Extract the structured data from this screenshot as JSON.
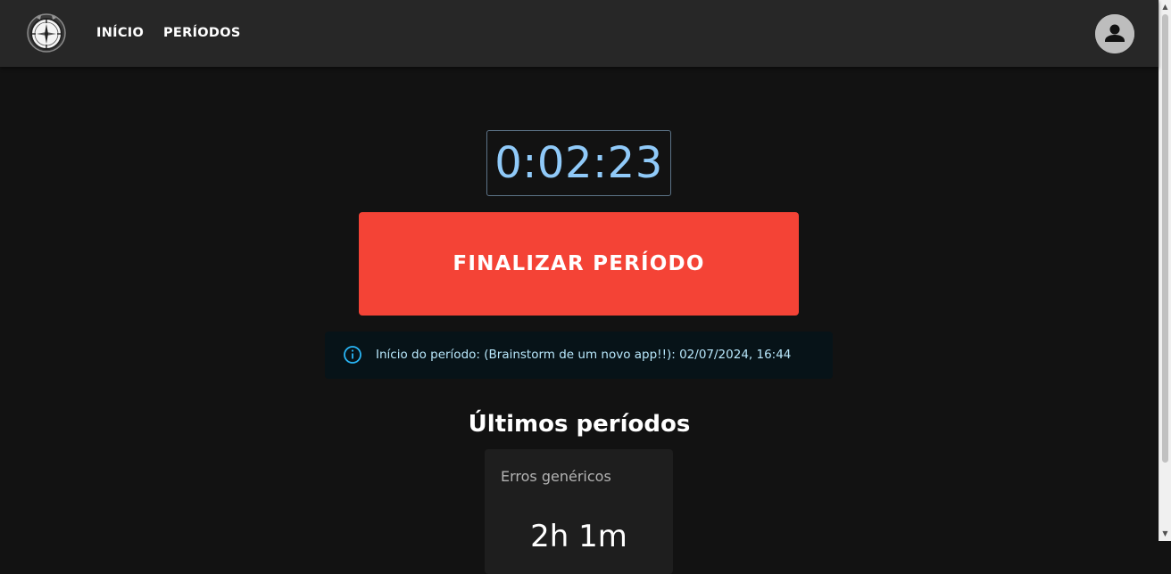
{
  "nav": {
    "logo_icon": "clock-compass-logo-icon",
    "links": [
      {
        "label": "INÍCIO"
      },
      {
        "label": "PERÍODOS"
      }
    ],
    "avatar_icon": "account-circle-icon"
  },
  "timer": {
    "value": "0:02:23",
    "color": "#90caf9"
  },
  "finish_button": {
    "label": "FINALIZAR PERÍODO",
    "color": "#f44336"
  },
  "info_alert": {
    "icon": "info-outline-icon",
    "text": "Início do período: (Brainstorm de um novo app!!): 02/07/2024, 16:44"
  },
  "recent_periods": {
    "title": "Últimos períodos",
    "items": [
      {
        "name": "Erros genéricos",
        "duration": "2h 1m"
      }
    ]
  }
}
